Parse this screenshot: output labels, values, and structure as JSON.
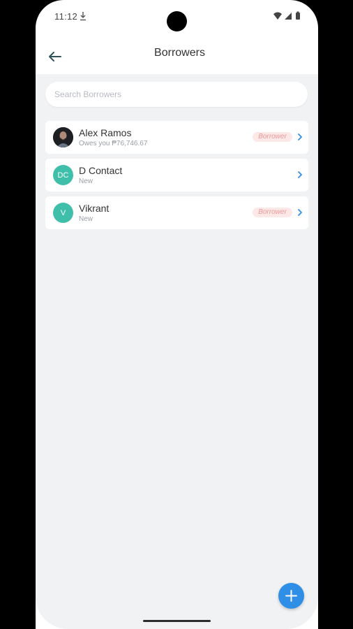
{
  "status_bar": {
    "time": "11:12",
    "download_icon": "download-icon",
    "wifi_icon": "wifi-icon",
    "signal_icon": "signal-icon",
    "battery_icon": "battery-icon"
  },
  "app_bar": {
    "title": "Borrowers",
    "back_icon": "arrow-left-icon"
  },
  "search": {
    "placeholder": "Search Borrowers",
    "value": ""
  },
  "borrowers": [
    {
      "name": "Alex Ramos",
      "subtitle": "Owes you ₱76,746.67",
      "avatar_type": "photo",
      "badge": "Borrower"
    },
    {
      "name": "D Contact",
      "subtitle": "New",
      "avatar_type": "initials",
      "initials": "DC",
      "badge": ""
    },
    {
      "name": "Vikrant",
      "subtitle": "New",
      "avatar_type": "initials",
      "initials": "V",
      "badge": "Borrower"
    }
  ],
  "fab": {
    "icon": "plus-icon"
  },
  "colors": {
    "accent": "#2f8fe6",
    "avatar_teal": "#3fbfaa",
    "badge_bg": "#fde8e8",
    "badge_text": "#e79a9a",
    "background": "#f1f2f4"
  }
}
